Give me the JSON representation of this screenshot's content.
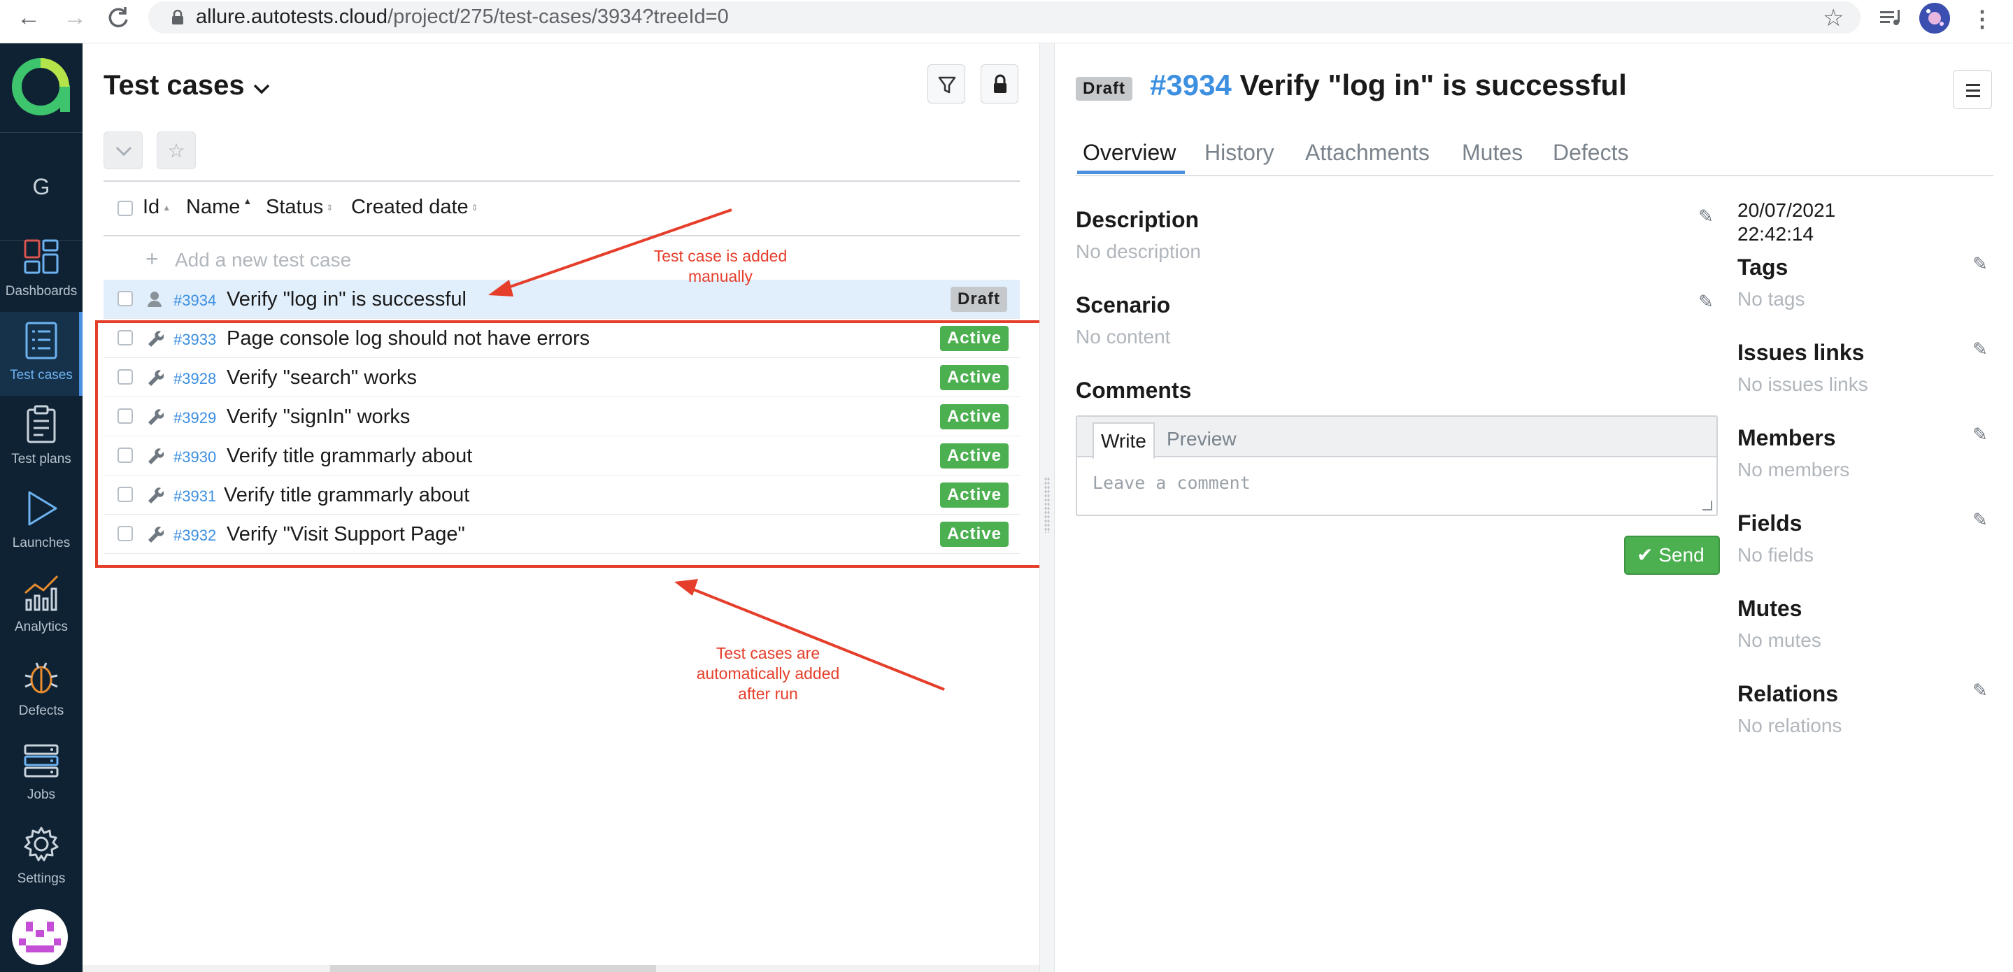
{
  "browser": {
    "url_host": "allure.autotests.cloud",
    "url_path": "/project/275/test-cases/3934?treeId=0"
  },
  "sidebar": {
    "user_initial": "G",
    "items": [
      {
        "label": "Dashboards",
        "icon": "dashboards-icon"
      },
      {
        "label": "Test cases",
        "icon": "test-cases-icon"
      },
      {
        "label": "Test plans",
        "icon": "test-plans-icon"
      },
      {
        "label": "Launches",
        "icon": "launches-icon"
      },
      {
        "label": "Analytics",
        "icon": "analytics-icon"
      },
      {
        "label": "Defects",
        "icon": "defects-icon"
      },
      {
        "label": "Jobs",
        "icon": "jobs-icon"
      },
      {
        "label": "Settings",
        "icon": "settings-icon"
      }
    ]
  },
  "list": {
    "title": "Test cases",
    "columns": [
      "Id",
      "Name",
      "Status",
      "Created date"
    ],
    "add_placeholder": "Add a new test case",
    "rows": [
      {
        "id": "#3934",
        "name": "Verify \"log in\" is successful",
        "status": "Draft",
        "type": "manual"
      },
      {
        "id": "#3933",
        "name": "Page console log should not have errors",
        "status": "Active",
        "type": "auto"
      },
      {
        "id": "#3928",
        "name": "Verify \"search\" works",
        "status": "Active",
        "type": "auto"
      },
      {
        "id": "#3929",
        "name": "Verify \"signIn\" works",
        "status": "Active",
        "type": "auto"
      },
      {
        "id": "#3930",
        "name": "Verify title grammarly about",
        "status": "Active",
        "type": "auto"
      },
      {
        "id": "#3931",
        "name": "Verify title grammarly about",
        "status": "Active",
        "type": "auto"
      },
      {
        "id": "#3932",
        "name": "Verify \"Visit Support Page\"",
        "status": "Active",
        "type": "auto"
      }
    ]
  },
  "annotations": {
    "manual_line1": "Test case is added",
    "manual_line2": "manually",
    "auto_line1": "Test cases are",
    "auto_line2": "automatically added",
    "auto_line3": "after run"
  },
  "detail": {
    "status": "Draft",
    "id": "#3934",
    "title": "Verify \"log in\" is successful",
    "tabs": [
      "Overview",
      "History",
      "Attachments",
      "Mutes",
      "Defects"
    ],
    "description_label": "Description",
    "description_value": "No description",
    "scenario_label": "Scenario",
    "scenario_value": "No content",
    "comments_label": "Comments",
    "write_tab": "Write",
    "preview_tab": "Preview",
    "comment_placeholder": "Leave a comment",
    "send_label": "Send",
    "created_date": "20/07/2021",
    "created_time": "22:42:14",
    "meta": [
      {
        "label": "Tags",
        "value": "No tags"
      },
      {
        "label": "Issues links",
        "value": "No issues links"
      },
      {
        "label": "Members",
        "value": "No members"
      },
      {
        "label": "Fields",
        "value": "No fields"
      },
      {
        "label": "Mutes",
        "value": "No mutes"
      },
      {
        "label": "Relations",
        "value": "No relations"
      }
    ]
  },
  "colors": {
    "sidebar_bg": "#0f2233",
    "accent_blue": "#3d8fe0",
    "active_green": "#4caf50",
    "annotation_red": "#e53e2b"
  }
}
